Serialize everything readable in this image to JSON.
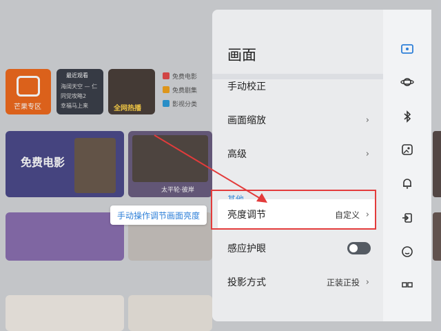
{
  "panel": {
    "title": "画面",
    "rows": [
      {
        "label": "手动校正"
      },
      {
        "label": "画面缩放",
        "chevron": "›"
      },
      {
        "label": "高级",
        "chevron": "›"
      }
    ],
    "section_label": "其他",
    "brightness": {
      "label": "亮度调节",
      "value": "自定义",
      "chevron": "›"
    },
    "eye_protection": {
      "label": "感应护眼",
      "toggle_on": false
    },
    "projection": {
      "label": "投影方式",
      "value": "正装正投",
      "chevron": "›"
    }
  },
  "tooltip": {
    "text": "手动操作调节画面亮度"
  },
  "background": {
    "tiles": [
      {
        "label": "芒果专区"
      },
      {
        "label": "最近观看"
      },
      {
        "label": "全网热播"
      },
      {
        "label": "免费电影"
      },
      {
        "label": "太平轮·彼岸"
      }
    ],
    "recent": [
      "海阔天空 — 仁",
      "同党攻略2",
      "幸福马上来"
    ],
    "side_list": [
      "免费电影",
      "免费剧集",
      "影视分类"
    ]
  },
  "colors": {
    "accent": "#2d7fd8",
    "highlight_border": "#e33b3b"
  },
  "icons": [
    "picture-icon",
    "planet-icon",
    "bluetooth-icon",
    "image-icon",
    "bell-icon",
    "input-source-icon",
    "smiley-icon"
  ]
}
